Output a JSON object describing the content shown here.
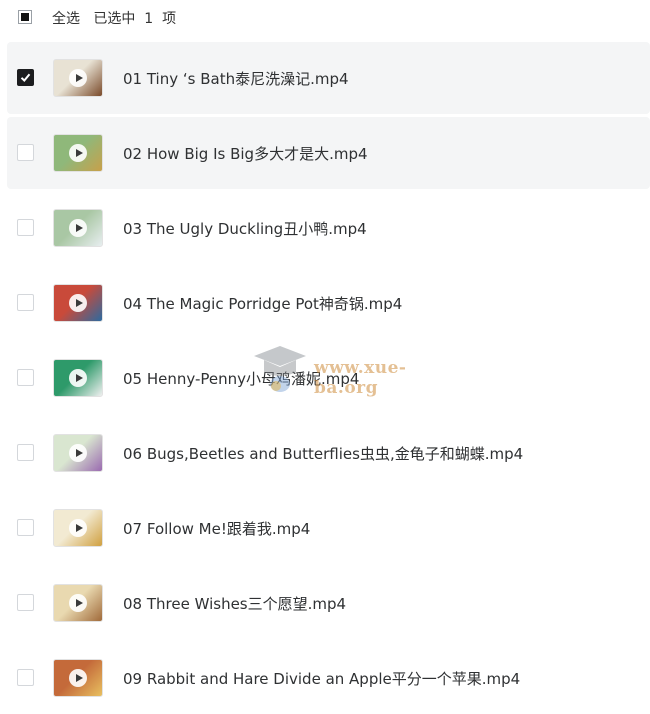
{
  "header": {
    "select_all": "全选",
    "selected_prefix": "已选中",
    "selected_count": "1",
    "selected_unit": "项"
  },
  "files": [
    {
      "name": "01 Tiny ‘s Bath泰尼洗澡记.mp4",
      "checked": true,
      "highlight": true,
      "thumb": [
        "#e8e2d4",
        "#7a4a2a"
      ]
    },
    {
      "name": "02 How Big Is Big多大才是大.mp4",
      "checked": false,
      "highlight": true,
      "thumb": [
        "#8fb87a",
        "#c8a04a"
      ]
    },
    {
      "name": "03 The Ugly Duckling丑小鸭.mp4",
      "checked": false,
      "highlight": false,
      "thumb": [
        "#a9c7a4",
        "#e8eef0"
      ]
    },
    {
      "name": "04 The Magic Porridge Pot神奇锅.mp4",
      "checked": false,
      "highlight": false,
      "thumb": [
        "#c94a3a",
        "#2c6aa0"
      ]
    },
    {
      "name": "05 Henny-Penny小母鸡潘妮.mp4",
      "checked": false,
      "highlight": false,
      "thumb": [
        "#2e9a6a",
        "#f0f0f0"
      ]
    },
    {
      "name": "06 Bugs,Beetles and Butterflies虫虫,金龟子和蝴蝶.mp4",
      "checked": false,
      "highlight": false,
      "thumb": [
        "#d9e6d0",
        "#9a6ab0"
      ]
    },
    {
      "name": "07 Follow Me!跟着我.mp4",
      "checked": false,
      "highlight": false,
      "thumb": [
        "#f2ead2",
        "#d0a040"
      ]
    },
    {
      "name": "08 Three Wishes三个愿望.mp4",
      "checked": false,
      "highlight": false,
      "thumb": [
        "#e9d9b0",
        "#a06a3a"
      ]
    },
    {
      "name": "09 Rabbit and Hare Divide an Apple平分一个苹果.mp4",
      "checked": false,
      "highlight": false,
      "thumb": [
        "#c46a3a",
        "#e8c060"
      ]
    }
  ],
  "watermark": {
    "text": "www.xue-ba.org",
    "icon": "graduation-cap-icon"
  }
}
